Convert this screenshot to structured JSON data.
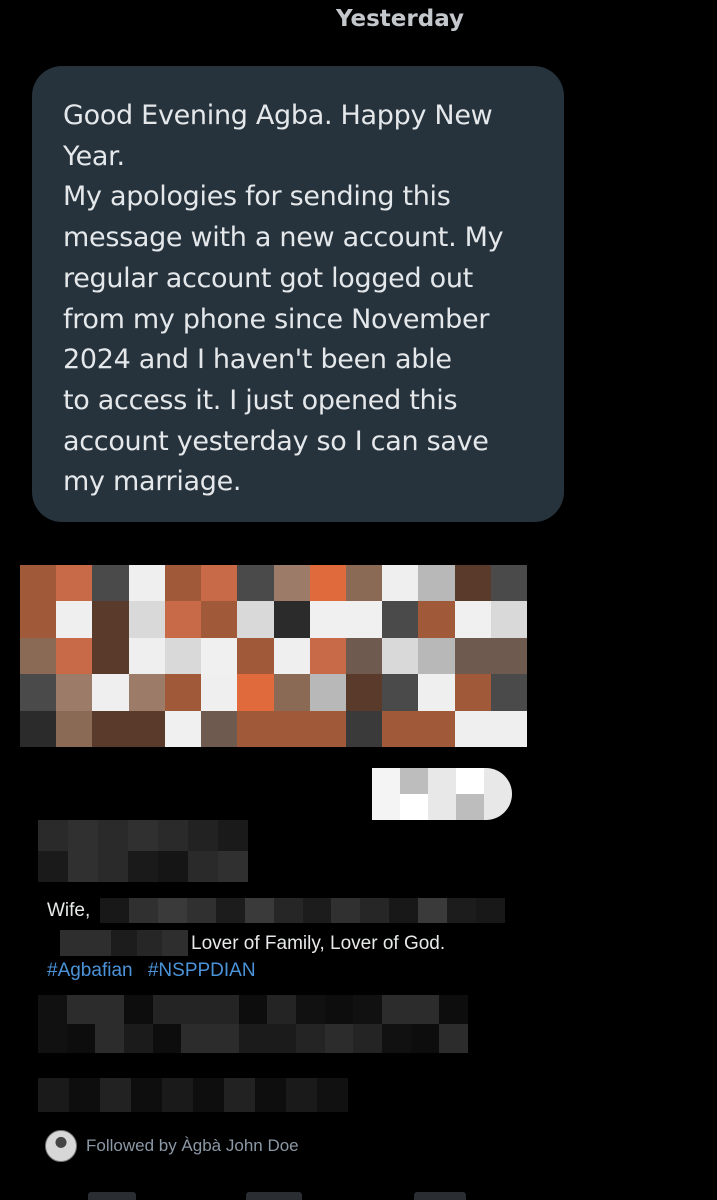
{
  "header": {
    "day_label": "Yesterday"
  },
  "message": {
    "lines": [
      "Good Evening Agba. Happy New",
      "Year.",
      "My apologies for sending this",
      "message with a new account. My",
      "regular account got logged out",
      "from my phone since November",
      "2024 and I haven't been able",
      "to access it.  I just opened this",
      "account yesterday so I can  save",
      "my marriage."
    ]
  },
  "profile": {
    "bio_prefix": "Wife,",
    "bio_suffix": "Lover of Family, Lover of God.",
    "hashtags": [
      "#Agbafian",
      "#NSPPDIAN"
    ],
    "followed_by": "Followed by Àgbà John Doe"
  },
  "colors": {
    "bubble": "#26323c",
    "hashtag": "#4b93d8",
    "muted": "#8b98a5"
  }
}
